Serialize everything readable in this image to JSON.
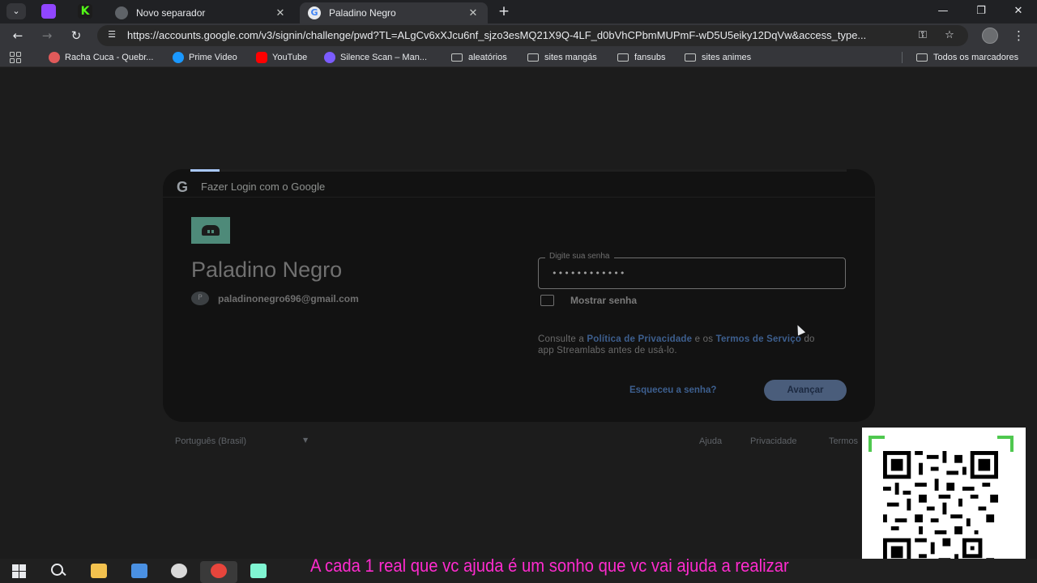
{
  "browser": {
    "tabs": [
      {
        "title": "Novo separador",
        "active": false,
        "favicon": "globe-icon"
      },
      {
        "title": "Paladino Negro",
        "active": true,
        "favicon": "google-icon"
      }
    ],
    "pinned_tabs": [
      {
        "favicon": "twitch-icon",
        "color": "#9146ff"
      },
      {
        "favicon": "kick-icon",
        "color": "#53fc18"
      }
    ],
    "url": "https://accounts.google.com/v3/signin/challenge/pwd?TL=ALgCv6xXJcu6nf_sjzo3esMQ21X9Q-4LF_d0bVhCPbmMUPmF-wD5U5eiky12DqVw&access_type...",
    "bookmarks": [
      {
        "label": "Racha Cuca - Quebr...",
        "icon": "rachacuca-icon",
        "color": "#e05a5a"
      },
      {
        "label": "Prime Video",
        "icon": "prime-video-icon",
        "color": "#1a98ff"
      },
      {
        "label": "YouTube",
        "icon": "youtube-icon",
        "color": "#ff0000"
      },
      {
        "label": "Silence Scan – Man...",
        "icon": "silence-scan-icon",
        "color": "#7b5cff"
      },
      {
        "label": "aleatórios",
        "icon": "folder-icon"
      },
      {
        "label": "sites mangás",
        "icon": "folder-icon"
      },
      {
        "label": "fansubs",
        "icon": "folder-icon"
      },
      {
        "label": "sites animes",
        "icon": "folder-icon"
      }
    ],
    "all_bookmarks": "Todos os marcadores"
  },
  "signin": {
    "header": "Fazer Login com o Google",
    "app_name": "Paladino Negro",
    "avatar_letter": "P",
    "email": "paladinonegro696@gmail.com",
    "password_label": "Digite sua senha",
    "password_value": "••••••••••••",
    "show_password": "Mostrar senha",
    "consent": {
      "prefix": "Consulte a ",
      "privacy": "Política de Privacidade",
      "middle": " e os ",
      "terms": "Termos de Serviço",
      "suffix": " do app Streamlabs antes de usá-lo."
    },
    "forgot": "Esqueceu a senha?",
    "next": "Avançar"
  },
  "footer": {
    "language": "Português (Brasil)",
    "help": "Ajuda",
    "privacy": "Privacidade",
    "terms": "Termos"
  },
  "overlay": {
    "ticker": "A  cada 1 real que vc ajuda é um sonho que vc vai ajuda a realizar",
    "ticker_color": "#ff2bcf",
    "qr_frame_color": "#4fc84f"
  },
  "taskbar": {
    "apps": [
      {
        "icon": "windows-start-icon"
      },
      {
        "icon": "search-icon"
      },
      {
        "icon": "file-explorer-icon",
        "color": "#f2c14e"
      },
      {
        "icon": "microsoft-store-icon",
        "color": "#4a90e2"
      },
      {
        "icon": "obs-icon",
        "color": "#d9d9d9"
      },
      {
        "icon": "chrome-icon",
        "color": "#e8453c"
      },
      {
        "icon": "streamlabs-icon",
        "color": "#80f5d2"
      }
    ]
  }
}
